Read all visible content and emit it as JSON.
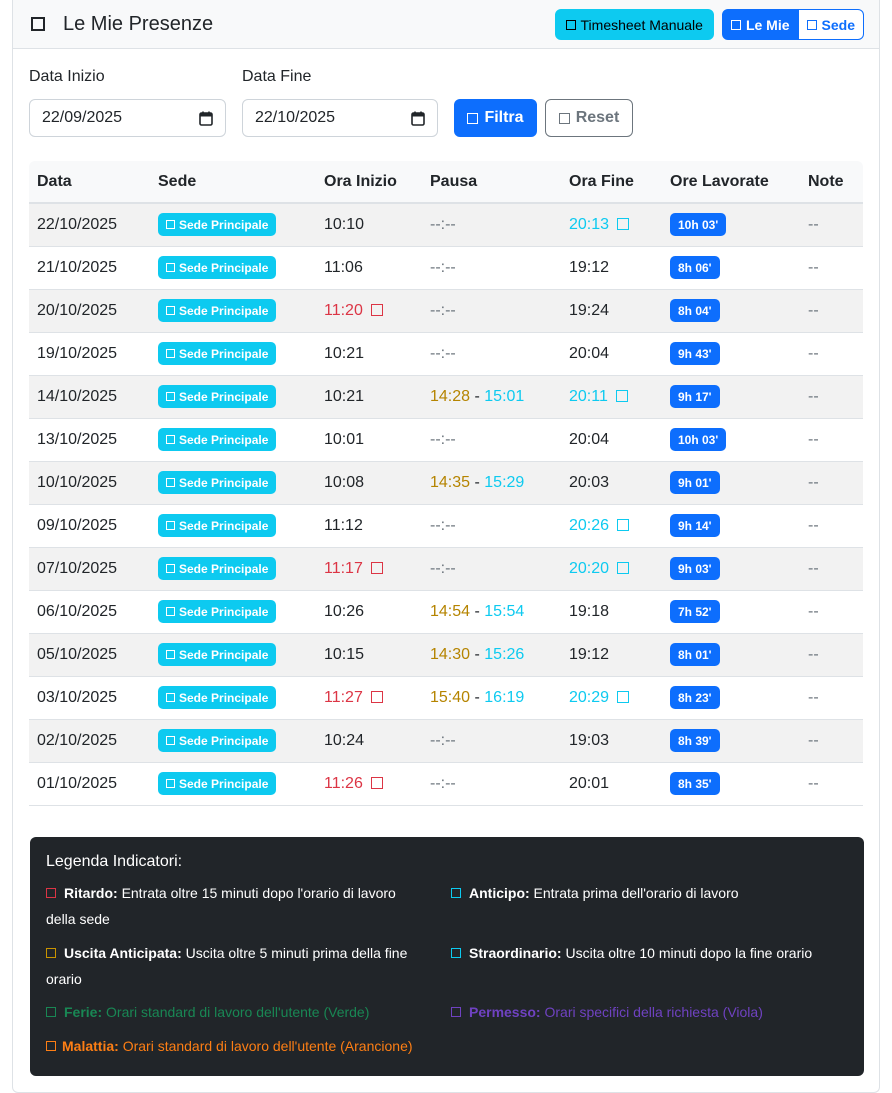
{
  "header": {
    "title": "Le Mie Presenze",
    "btn_timesheet": "Timesheet Manuale",
    "btn_le_mie": "Le Mie",
    "btn_sede": "Sede"
  },
  "filters": {
    "start_label": "Data Inizio",
    "start_value": "22/09/2025",
    "end_label": "Data Fine",
    "end_value": "22/10/2025",
    "filter_label": "Filtra",
    "reset_label": "Reset"
  },
  "table": {
    "columns": [
      "Data",
      "Sede",
      "Ora Inizio",
      "Pausa",
      "Ora Fine",
      "Ore Lavorate",
      "Note"
    ],
    "rows": [
      {
        "date": "22/10/2025",
        "sede": "Sede Principale",
        "start": "10:10",
        "late": false,
        "pause": "--:--",
        "pause_start": "",
        "pause_end": "",
        "end": "20:13",
        "overtime": true,
        "hours": "10h 03'",
        "note": "--"
      },
      {
        "date": "21/10/2025",
        "sede": "Sede Principale",
        "start": "11:06",
        "late": false,
        "pause": "--:--",
        "pause_start": "",
        "pause_end": "",
        "end": "19:12",
        "overtime": false,
        "hours": "8h 06'",
        "note": "--"
      },
      {
        "date": "20/10/2025",
        "sede": "Sede Principale",
        "start": "11:20",
        "late": true,
        "pause": "--:--",
        "pause_start": "",
        "pause_end": "",
        "end": "19:24",
        "overtime": false,
        "hours": "8h 04'",
        "note": "--"
      },
      {
        "date": "19/10/2025",
        "sede": "Sede Principale",
        "start": "10:21",
        "late": false,
        "pause": "--:--",
        "pause_start": "",
        "pause_end": "",
        "end": "20:04",
        "overtime": false,
        "hours": "9h 43'",
        "note": "--"
      },
      {
        "date": "14/10/2025",
        "sede": "Sede Principale",
        "start": "10:21",
        "late": false,
        "pause": "",
        "pause_start": "14:28",
        "pause_end": "15:01",
        "end": "20:11",
        "overtime": true,
        "hours": "9h 17'",
        "note": "--"
      },
      {
        "date": "13/10/2025",
        "sede": "Sede Principale",
        "start": "10:01",
        "late": false,
        "pause": "--:--",
        "pause_start": "",
        "pause_end": "",
        "end": "20:04",
        "overtime": false,
        "hours": "10h 03'",
        "note": "--"
      },
      {
        "date": "10/10/2025",
        "sede": "Sede Principale",
        "start": "10:08",
        "late": false,
        "pause": "",
        "pause_start": "14:35",
        "pause_end": "15:29",
        "end": "20:03",
        "overtime": false,
        "hours": "9h 01'",
        "note": "--"
      },
      {
        "date": "09/10/2025",
        "sede": "Sede Principale",
        "start": "11:12",
        "late": false,
        "pause": "--:--",
        "pause_start": "",
        "pause_end": "",
        "end": "20:26",
        "overtime": true,
        "hours": "9h 14'",
        "note": "--"
      },
      {
        "date": "07/10/2025",
        "sede": "Sede Principale",
        "start": "11:17",
        "late": true,
        "pause": "--:--",
        "pause_start": "",
        "pause_end": "",
        "end": "20:20",
        "overtime": true,
        "hours": "9h 03'",
        "note": "--"
      },
      {
        "date": "06/10/2025",
        "sede": "Sede Principale",
        "start": "10:26",
        "late": false,
        "pause": "",
        "pause_start": "14:54",
        "pause_end": "15:54",
        "end": "19:18",
        "overtime": false,
        "hours": "7h 52'",
        "note": "--"
      },
      {
        "date": "05/10/2025",
        "sede": "Sede Principale",
        "start": "10:15",
        "late": false,
        "pause": "",
        "pause_start": "14:30",
        "pause_end": "15:26",
        "end": "19:12",
        "overtime": false,
        "hours": "8h 01'",
        "note": "--"
      },
      {
        "date": "03/10/2025",
        "sede": "Sede Principale",
        "start": "11:27",
        "late": true,
        "pause": "",
        "pause_start": "15:40",
        "pause_end": "16:19",
        "end": "20:29",
        "overtime": true,
        "hours": "8h 23'",
        "note": "--"
      },
      {
        "date": "02/10/2025",
        "sede": "Sede Principale",
        "start": "10:24",
        "late": false,
        "pause": "--:--",
        "pause_start": "",
        "pause_end": "",
        "end": "19:03",
        "overtime": false,
        "hours": "8h 39'",
        "note": "--"
      },
      {
        "date": "01/10/2025",
        "sede": "Sede Principale",
        "start": "11:26",
        "late": true,
        "pause": "--:--",
        "pause_start": "",
        "pause_end": "",
        "end": "20:01",
        "overtime": false,
        "hours": "8h 35'",
        "note": "--"
      }
    ]
  },
  "legend": {
    "title": "Legenda Indicatori:",
    "ritardo_label": "Ritardo:",
    "ritardo_text": "Entrata oltre 15 minuti dopo l'orario di lavoro",
    "ritardo_text2": "della sede",
    "anticipo_label": "Anticipo:",
    "anticipo_text": "Entrata prima dell'orario di lavoro",
    "uscita_label": "Uscita Anticipata:",
    "uscita_text": "Uscita oltre 5 minuti prima della fine",
    "uscita_text2": "orario",
    "straordinario_label": "Straordinario:",
    "straordinario_text": "Uscita oltre 10 minuti dopo la fine orario",
    "ferie_label": "Ferie:",
    "ferie_text": "Orari standard di lavoro dell'utente (Verde)",
    "permesso_label": "Permesso:",
    "permesso_text": "Orari specifici della richiesta (Viola)",
    "malattia_label": "Malattia:",
    "malattia_text": "Orari standard di lavoro dell'utente (Arancione)"
  },
  "colors": {
    "primary": "#0d6efd",
    "info": "#0dcaf0",
    "danger": "#dc3545",
    "warning": "#b58400",
    "success": "#198754",
    "purple": "#6f42c1",
    "orange": "#fd7e14",
    "dark": "#212529"
  },
  "icons": {
    "header": "square-icon",
    "calendar": "calendar-icon",
    "indicator": "square-indicator-icon"
  }
}
